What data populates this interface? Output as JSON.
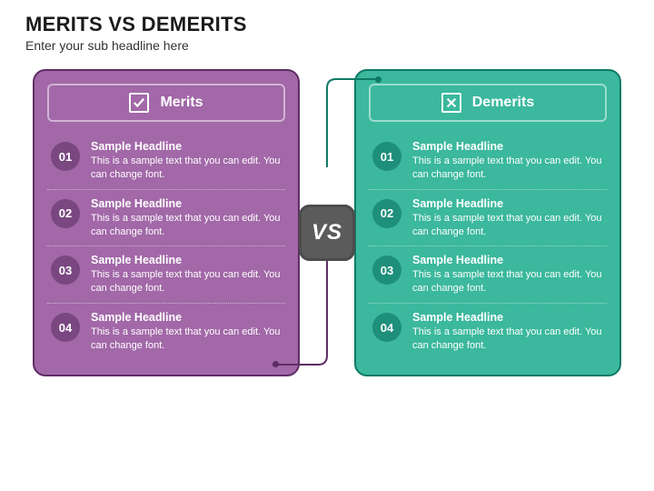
{
  "title": "MERITS VS DEMERITS",
  "subtitle": "Enter your sub headline here",
  "vs_label": "VS",
  "colors": {
    "merits_bg": "#a268a8",
    "merits_border": "#5e2d64",
    "merits_num": "#7a4780",
    "demerits_bg": "#3bb89d",
    "demerits_border": "#0e7a66",
    "demerits_num": "#1e8f7a",
    "vs_bg": "#5b5b5b"
  },
  "merits": {
    "label": "Merits",
    "icon": "check-icon",
    "items": [
      {
        "num": "01",
        "headline": "Sample Headline",
        "body": "This is a sample text that you can edit. You can change font."
      },
      {
        "num": "02",
        "headline": "Sample Headline",
        "body": "This is a sample text that you can edit. You can change font."
      },
      {
        "num": "03",
        "headline": "Sample Headline",
        "body": "This is a sample text that you can edit. You can change font."
      },
      {
        "num": "04",
        "headline": "Sample Headline",
        "body": "This is a sample text that you can edit. You can change font."
      }
    ]
  },
  "demerits": {
    "label": "Demerits",
    "icon": "cross-icon",
    "items": [
      {
        "num": "01",
        "headline": "Sample Headline",
        "body": "This is a sample text that you can edit. You can change font."
      },
      {
        "num": "02",
        "headline": "Sample Headline",
        "body": "This is a sample text that you can edit. You can change font."
      },
      {
        "num": "03",
        "headline": "Sample Headline",
        "body": "This is a sample text that you can edit. You can change font."
      },
      {
        "num": "04",
        "headline": "Sample Headline",
        "body": "This is a sample text that you can edit. You can change font."
      }
    ]
  }
}
